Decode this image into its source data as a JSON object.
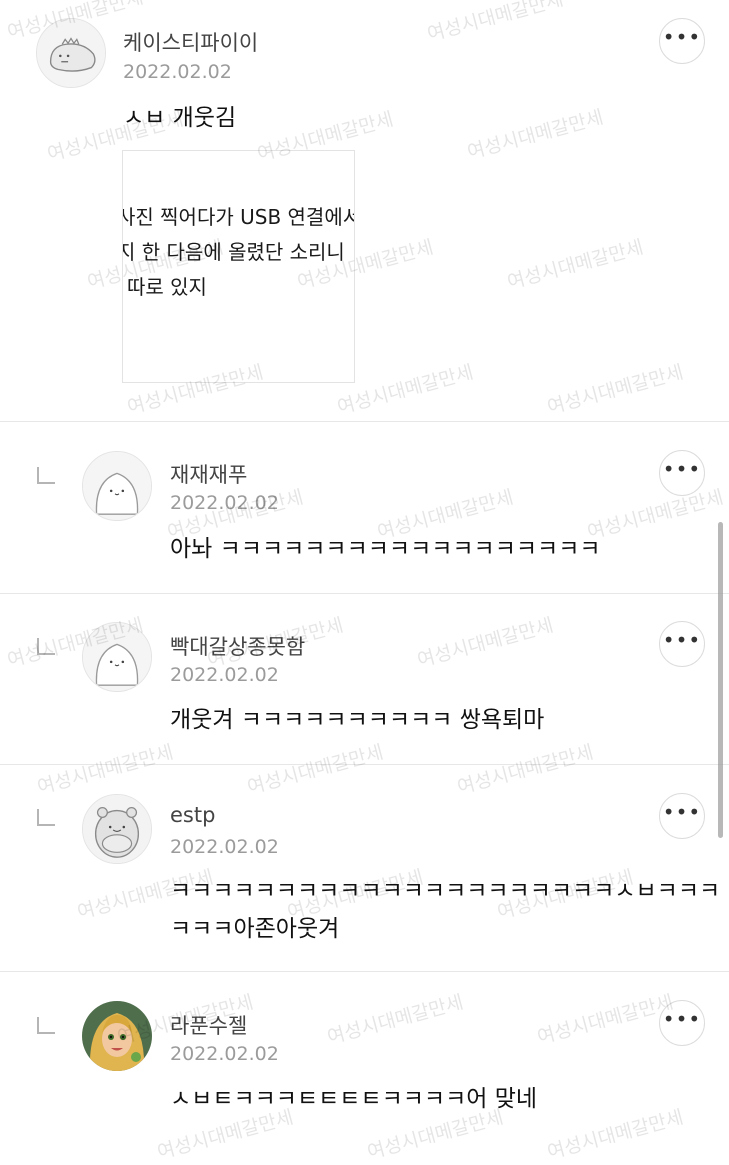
{
  "comments": [
    {
      "nickname": "케이스티파이이",
      "date": "2022.02.02",
      "text": "ㅅㅂ 개웃김",
      "avatar": "dino-avatar-icon",
      "image_lines": [
        "사진 찍어다가 USB 연결에서",
        "지 한 다음에 올렸단 소리니",
        "따로 있지"
      ],
      "reply": false
    },
    {
      "nickname": "재재재푸",
      "date": "2022.02.02",
      "text": "아놔 ㅋㅋㅋㅋㅋㅋㅋㅋㅋㅋㅋㅋㅋㅋㅋㅋㅋㅋ",
      "avatar": "default-avatar-icon",
      "reply": true
    },
    {
      "nickname": "빡대갈상종못함",
      "date": "2022.02.02",
      "text": "개웃겨 ㅋㅋㅋㅋㅋㅋㅋㅋㅋㅋ 쌍욕퇴마",
      "avatar": "default-avatar-icon",
      "reply": true
    },
    {
      "nickname": "estp",
      "date": "2022.02.02",
      "text_line1": "ㅋㅋㅋㅋㅋㅋㅋㅋㅋㅋㅋㅋㅋㅋㅋㅋㅋㅋㅋㅋㅋㅅㅂㅋㅋㅋ",
      "text_line2": "ㅋㅋㅋ아존아웃겨",
      "avatar": "hippo-avatar-icon",
      "reply": true
    },
    {
      "nickname": "라푼수젤",
      "date": "2022.02.02",
      "text": "ㅅㅂㅌㅋㅋㅋㅌㅌㅌㅌㅋㅋㅋㅋ어 맞네",
      "avatar": "rapunzel-avatar-icon",
      "reply": true
    }
  ],
  "more_label": "•••",
  "watermark": "여성시대메갈만세",
  "colors": {
    "nickname": "#444444",
    "date": "#9b9b9b",
    "divider": "#e7e7e7"
  }
}
